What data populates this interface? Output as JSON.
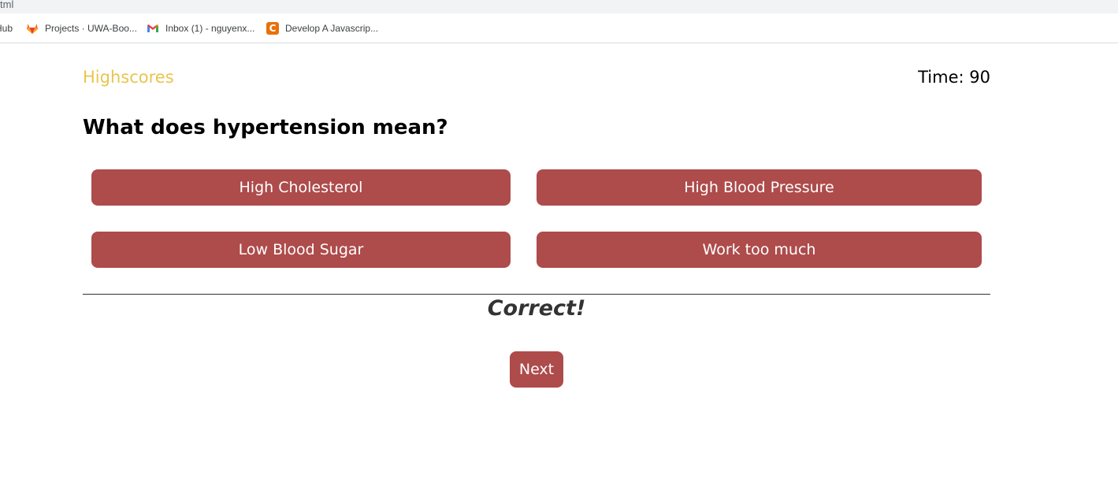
{
  "browser": {
    "url_fragment": "tml",
    "bookmarks": [
      {
        "label": "Hub",
        "icon": "none"
      },
      {
        "label": "Projects · UWA-Boo...",
        "icon": "gitlab-icon"
      },
      {
        "label": "Inbox (1) - nguyenx...",
        "icon": "gmail-icon"
      },
      {
        "label": "Develop A Javascrip...",
        "icon": "c-icon",
        "icon_text": "C"
      }
    ]
  },
  "header": {
    "highscores_label": "Highscores",
    "timer_label": "Time: 90"
  },
  "quiz": {
    "question": "What does hypertension mean?",
    "answers": [
      "High Cholesterol",
      "High Blood Pressure",
      "Low Blood Sugar",
      "Work too much"
    ],
    "feedback": "Correct!",
    "next_label": "Next"
  },
  "colors": {
    "accent": "#ae4b4b",
    "highscores_link": "#e8c54e",
    "feedback_text": "#333333"
  }
}
